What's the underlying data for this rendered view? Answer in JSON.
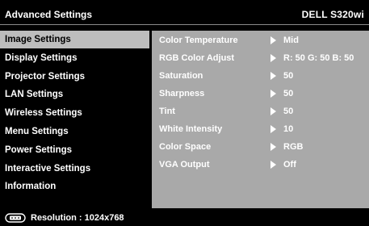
{
  "header": {
    "title": "Advanced Settings",
    "model": "DELL S320wi"
  },
  "menu": {
    "items": [
      {
        "label": "Image Settings",
        "selected": true
      },
      {
        "label": "Display Settings"
      },
      {
        "label": "Projector Settings"
      },
      {
        "label": "LAN Settings"
      },
      {
        "label": "Wireless Settings"
      },
      {
        "label": "Menu Settings"
      },
      {
        "label": "Power Settings"
      },
      {
        "label": "Interactive Settings"
      },
      {
        "label": "Information"
      }
    ]
  },
  "settings": {
    "rows": [
      {
        "label": "Color Temperature",
        "value": "Mid"
      },
      {
        "label": "RGB Color Adjust",
        "value": "R: 50 G: 50 B: 50"
      },
      {
        "label": "Saturation",
        "value": "50"
      },
      {
        "label": "Sharpness",
        "value": "50"
      },
      {
        "label": "Tint",
        "value": "50"
      },
      {
        "label": "White Intensity",
        "value": "10"
      },
      {
        "label": "Color Space",
        "value": "RGB"
      },
      {
        "label": "VGA Output",
        "value": "Off"
      }
    ]
  },
  "footer": {
    "icon": "input-source-icon",
    "text": "Resolution : 1024x768"
  },
  "colors": {
    "selected_bg": "#bdbdbd",
    "panel_bg": "#a9a9a9",
    "background": "#000000"
  }
}
